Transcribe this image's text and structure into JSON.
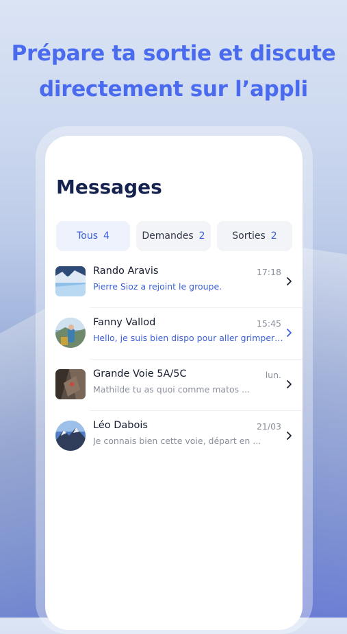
{
  "headline": {
    "line1": "Prépare ta sortie et discute",
    "line2": "directement sur l’appli"
  },
  "screen": {
    "title": "Messages",
    "tabs": [
      {
        "label": "Tous",
        "count": "4",
        "active": true
      },
      {
        "label": "Demandes",
        "count": "2",
        "active": false
      },
      {
        "label": "Sorties",
        "count": "2",
        "active": false
      }
    ],
    "conversations": [
      {
        "name": "Rando Aravis",
        "time": "17:18",
        "message": "Pierre Sioz a rejoint le groupe.",
        "unread": true,
        "avatar": "group-photo-snowy-lake"
      },
      {
        "name": "Fanny Vallod",
        "time": "15:45",
        "message": "Hello, je suis bien dispo pour aller grimper ...",
        "unread": true,
        "avatar": "user-photo-hiker"
      },
      {
        "name": "Grande Voie 5A/5C",
        "time": "lun.",
        "message": "Mathilde tu as quoi comme matos ...",
        "unread": false,
        "avatar": "group-photo-rock-climbing"
      },
      {
        "name": "Léo Dabois",
        "time": "21/03",
        "message": "Je connais bien cette voie, départ en ...",
        "unread": false,
        "avatar": "user-photo-mountain"
      }
    ]
  },
  "colors": {
    "accent": "#3b5fd9",
    "headline": "#4b6bee",
    "title": "#17234f"
  }
}
